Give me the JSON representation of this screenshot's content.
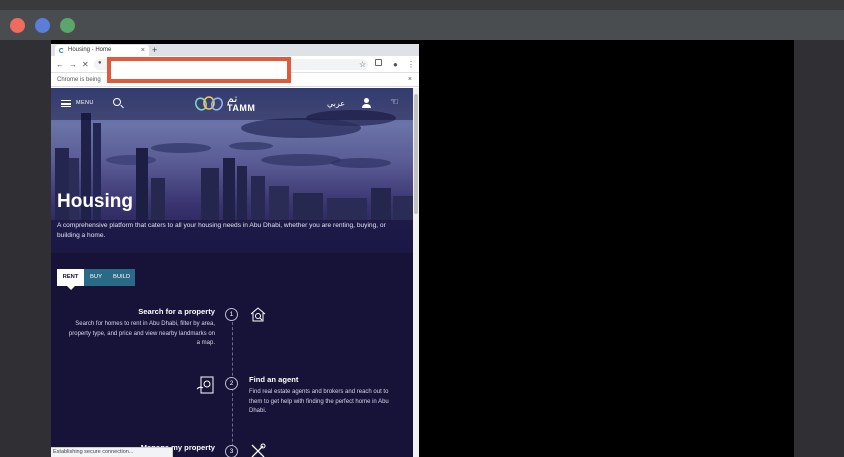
{
  "mac_window": {
    "traffic_lights": [
      {
        "name": "close-dot",
        "color": "#ee6b5e"
      },
      {
        "name": "minimize-dot",
        "color": "#5b7fd8"
      },
      {
        "name": "zoom-dot",
        "color": "#5aa66c"
      }
    ]
  },
  "browser": {
    "tab_title": "Housing - Home",
    "tab_close_icon": "×",
    "new_tab_icon": "+",
    "nav": {
      "back": "←",
      "forward": "→",
      "stop": "✕",
      "star": "☆",
      "account": "●",
      "menu": "⋮"
    },
    "infobar_text": "Chrome is being",
    "infobar_close": "×",
    "status_text": "Establishing secure connection..."
  },
  "site": {
    "menu_label": "MENU",
    "logo_ar": "تم",
    "logo_en": "TAMM",
    "arabic_link": "عربي",
    "hero": {
      "title": "Housing",
      "description": "A comprehensive platform that caters to all your housing needs in Abu Dhabi, whether you are renting, buying, or building a home."
    },
    "tabs": [
      {
        "label": "RENT",
        "active": true
      },
      {
        "label": "BUY",
        "active": false
      },
      {
        "label": "BUILD",
        "active": false
      }
    ],
    "steps": [
      {
        "number": "1",
        "title": "Search for a property",
        "description": "Search for homes to rent in Abu Dhabi, filter by area, property type, and price and view nearby landmarks on a map.",
        "icon": "house-search-icon"
      },
      {
        "number": "2",
        "title": "Find an agent",
        "description": "Find real estate agents and brokers and reach out to them to get help with finding the perfect home in Abu Dhabi.",
        "icon": "agent-id-icon"
      },
      {
        "number": "3",
        "title": "Manage my property",
        "description": "",
        "icon": "tools-icon"
      }
    ]
  }
}
